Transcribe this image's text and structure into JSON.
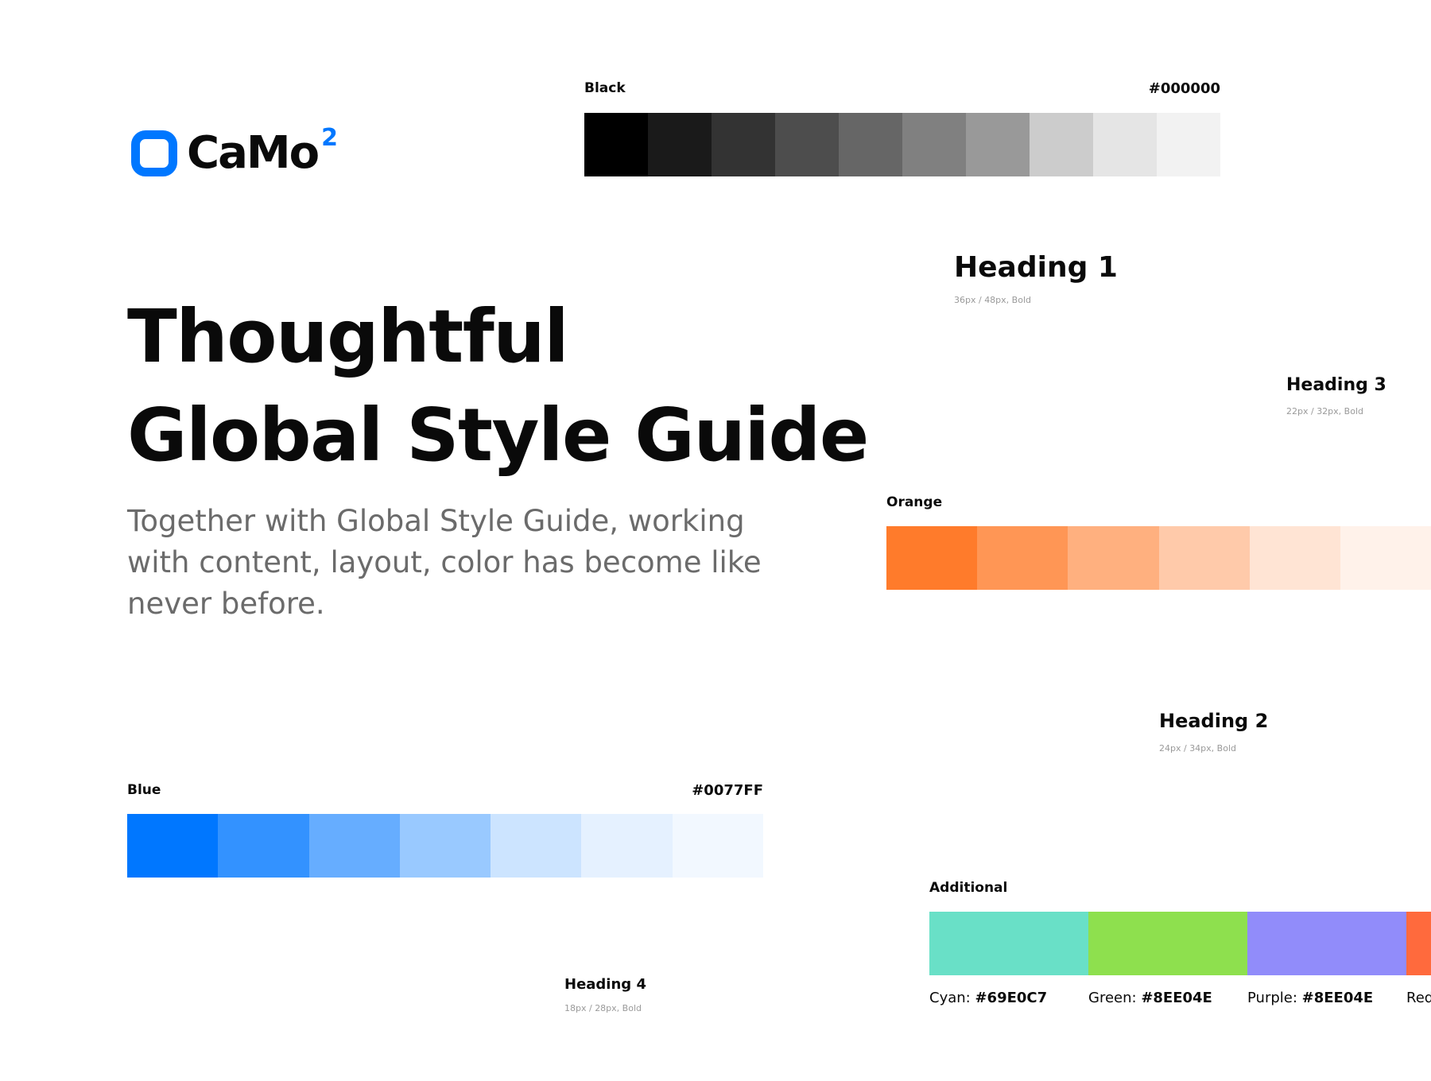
{
  "logo": {
    "name": "CaMo",
    "superscript": "2",
    "icon": "rounded-square-logo-icon"
  },
  "hero": {
    "title_line1": "Thoughtful",
    "title_line2": "Global Style Guide",
    "subtitle": "Together with Global Style Guide, working with content, layout, color has become like never before."
  },
  "palettes": {
    "black": {
      "label": "Black",
      "hex": "#000000",
      "swatches": [
        "#000000",
        "#1a1a1a",
        "#333333",
        "#4d4d4d",
        "#666666",
        "#808080",
        "#999999",
        "#cccccc",
        "#e5e5e5",
        "#f2f2f2"
      ]
    },
    "orange": {
      "label": "Orange",
      "swatches": [
        "#FF7B2B",
        "#FF9655",
        "#FFB07F",
        "#FFCAAA",
        "#FFE4D4",
        "#FFF2EA"
      ]
    },
    "blue": {
      "label": "Blue",
      "hex": "#0077FF",
      "swatches": [
        "#0077FF",
        "#3392FF",
        "#66ADFF",
        "#99C9FF",
        "#CCE4FF",
        "#E5F1FF",
        "#F2F8FF"
      ]
    }
  },
  "headings": {
    "h1": {
      "title": "Heading 1",
      "meta": "36px / 48px, Bold"
    },
    "h2": {
      "title": "Heading 2",
      "meta": "24px / 34px, Bold"
    },
    "h3": {
      "title": "Heading 3",
      "meta": "22px / 32px, Bold"
    },
    "h4": {
      "title": "Heading 4",
      "meta": "18px / 28px, Bold"
    }
  },
  "additional": {
    "label": "Additional",
    "colors": [
      {
        "name": "Cyan:",
        "hex": "#69E0C7",
        "swatch": "#69E0C7"
      },
      {
        "name": "Green:",
        "hex": "#8EE04E",
        "swatch": "#8EE04E"
      },
      {
        "name": "Purple:",
        "hex": "#8EE04E",
        "swatch": "#918CFA"
      },
      {
        "name": "Red",
        "hex": "",
        "swatch": "#FF6A3D"
      }
    ]
  }
}
